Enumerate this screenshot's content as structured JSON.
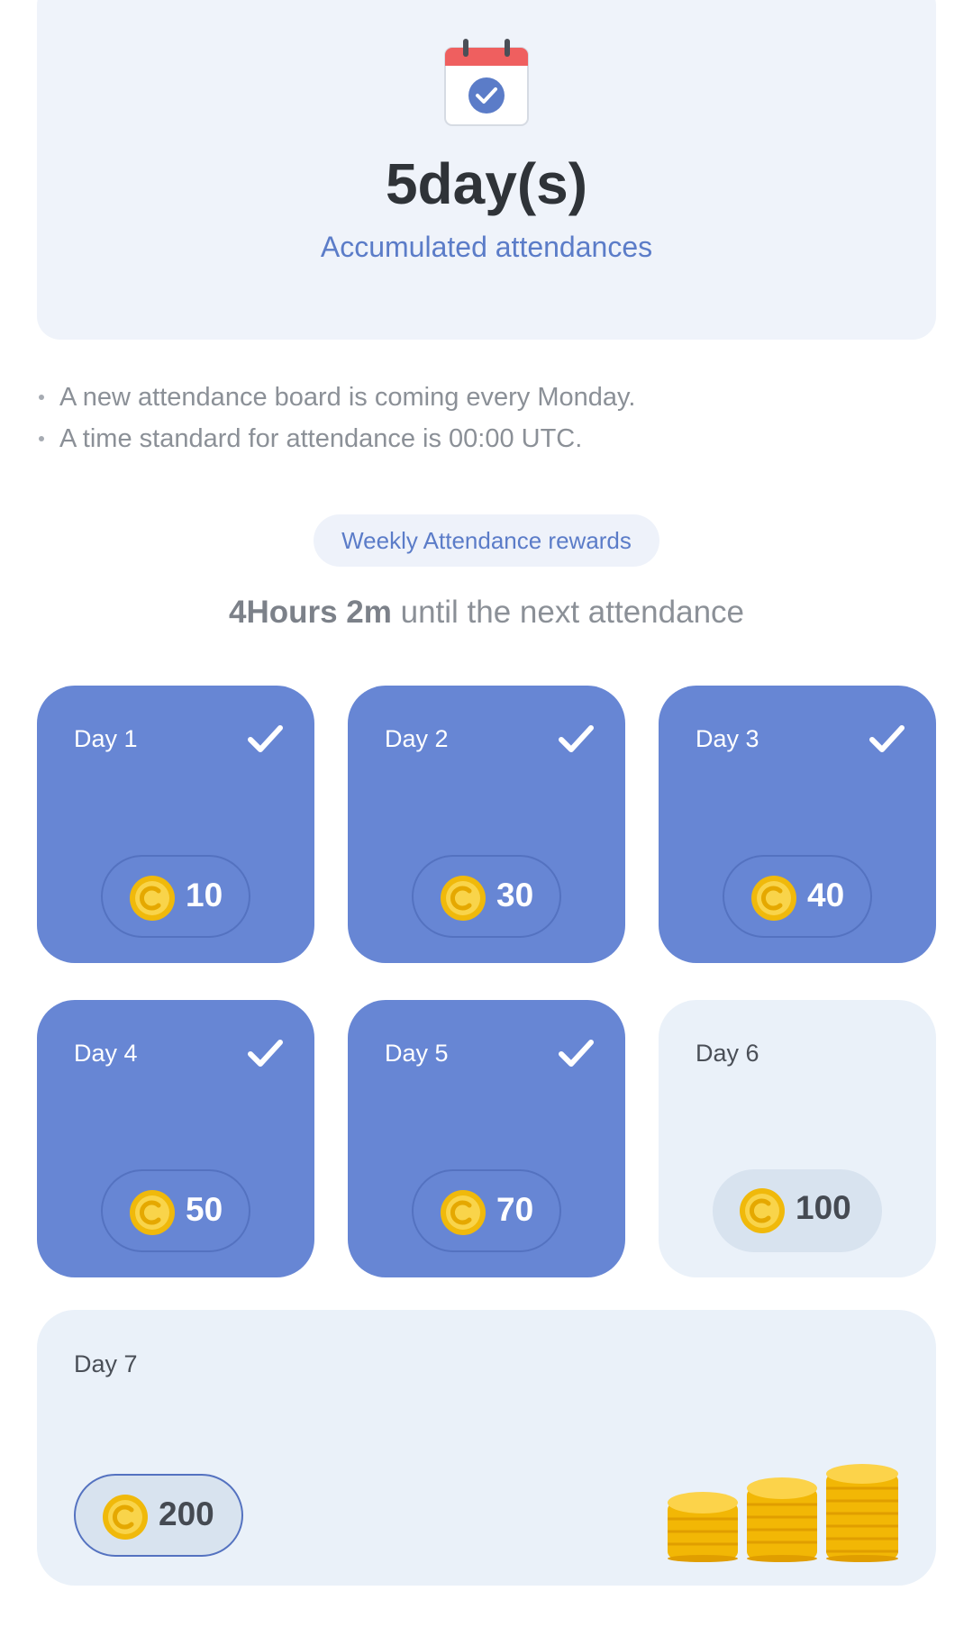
{
  "summary": {
    "count": "5day(s)",
    "label": "Accumulated attendances"
  },
  "notes": [
    "A new attendance board is coming every Monday.",
    "A time standard for attendance is 00:00 UTC."
  ],
  "weekly_badge": "Weekly Attendance rewards",
  "countdown": {
    "time": "4Hours 2m",
    "suffix": " until the next attendance"
  },
  "days": [
    {
      "label": "Day 1",
      "reward": "10",
      "checked": true
    },
    {
      "label": "Day 2",
      "reward": "30",
      "checked": true
    },
    {
      "label": "Day 3",
      "reward": "40",
      "checked": true
    },
    {
      "label": "Day 4",
      "reward": "50",
      "checked": true
    },
    {
      "label": "Day 5",
      "reward": "70",
      "checked": true
    },
    {
      "label": "Day 6",
      "reward": "100",
      "checked": false
    },
    {
      "label": "Day 7",
      "reward": "200",
      "checked": false
    }
  ],
  "colors": {
    "accent": "#6786d4",
    "pending": "#eaf1f9",
    "link": "#5b7cc8",
    "coin": "#f5c518"
  },
  "icons": {
    "calendar": "calendar-check-icon",
    "check": "check-icon",
    "coin": "coin-icon",
    "coin_stacks": "coin-stacks-icon"
  }
}
